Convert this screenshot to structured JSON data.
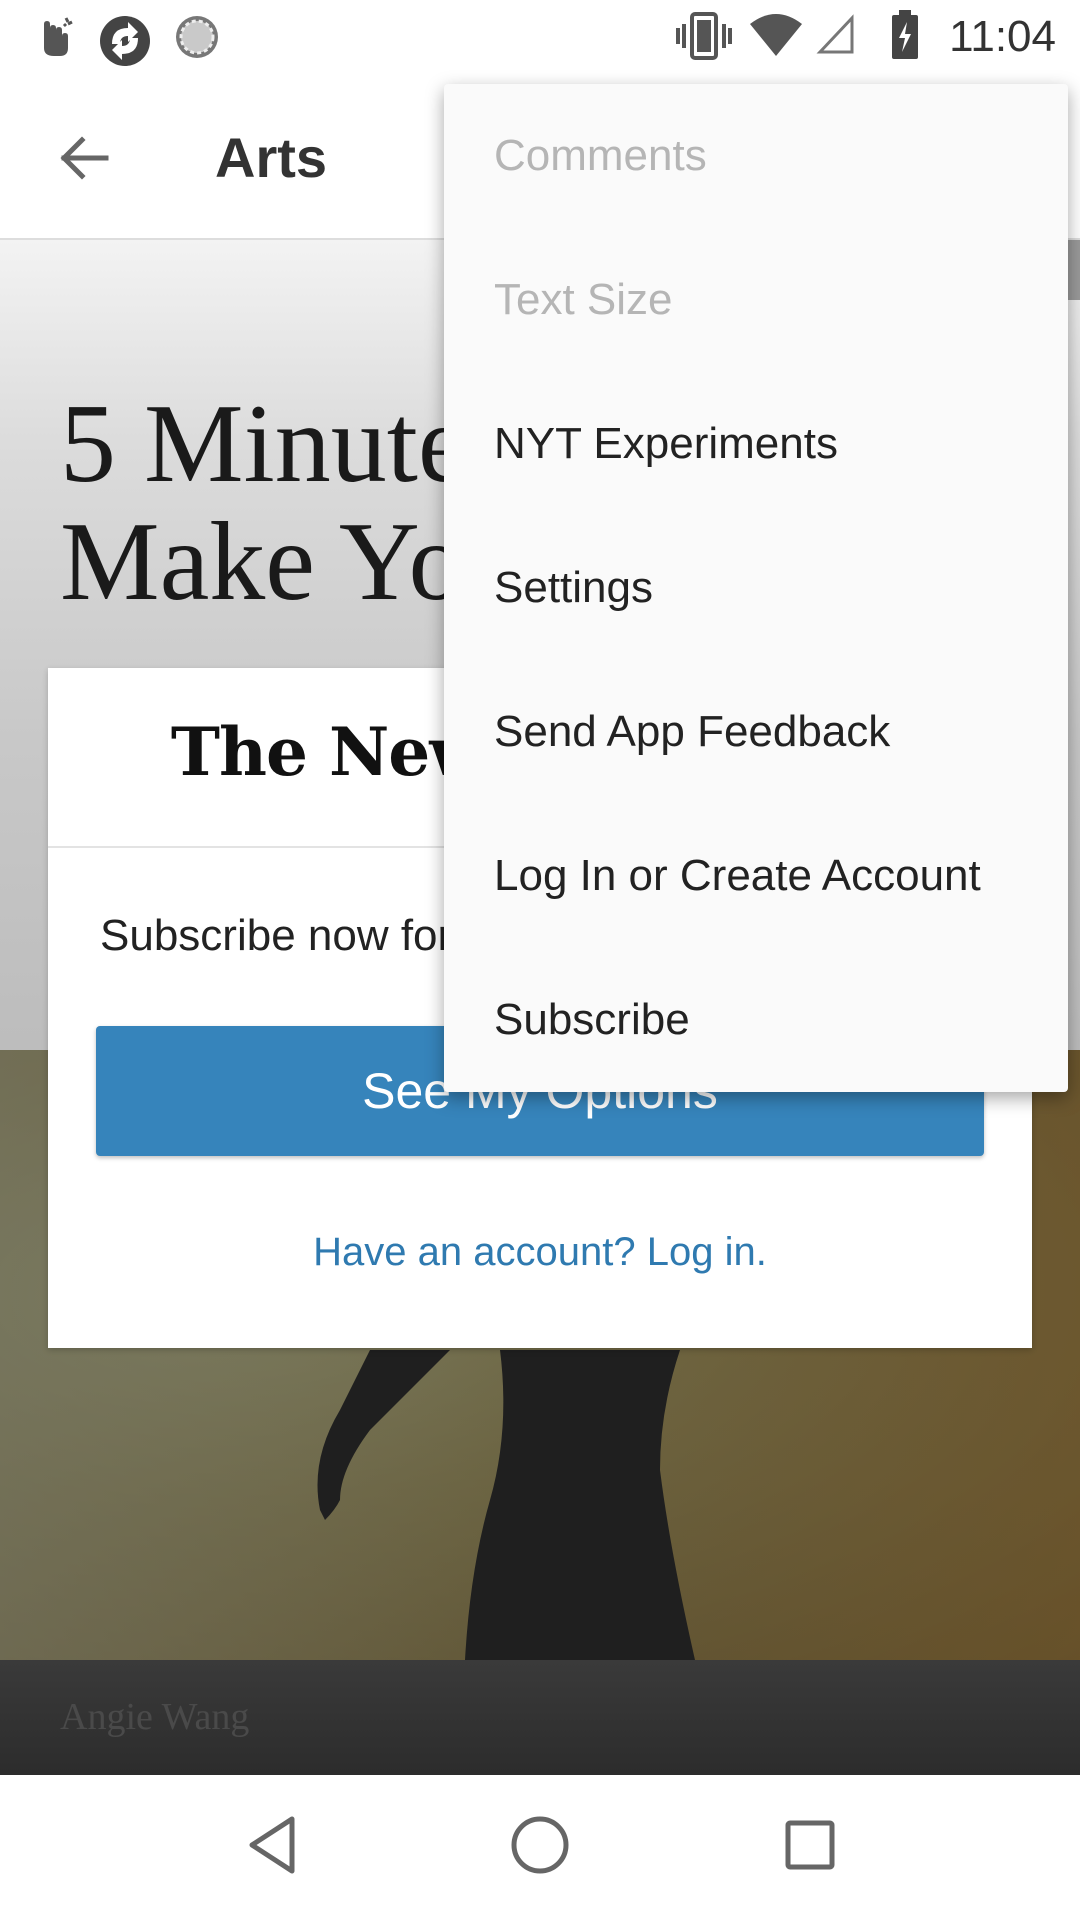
{
  "status_bar": {
    "time": "11:04",
    "left_icons": [
      "gesture-icon",
      "app-sync-icon",
      "loading-icon"
    ],
    "right_icons": [
      "vibrate-icon",
      "wifi-icon",
      "cell-signal-icon",
      "battery-charging-icon"
    ]
  },
  "toolbar": {
    "title": "Arts",
    "back_icon": "back-arrow-icon"
  },
  "article": {
    "headline_line1": "5 Minute",
    "headline_line2": "Make You",
    "photo_credit": "Angie Wang"
  },
  "paywall": {
    "logo_text": "The New York Times",
    "subscribe_text": "Subscribe now for unlimited access.",
    "options_button": "See My Options",
    "login_link": "Have an account? Log in.",
    "button_color": "#3684bb",
    "link_color": "#2f7ab0"
  },
  "overflow_menu": {
    "items": [
      {
        "label": "Comments",
        "enabled": false
      },
      {
        "label": "Text Size",
        "enabled": false
      },
      {
        "label": "NYT Experiments",
        "enabled": true
      },
      {
        "label": "Settings",
        "enabled": true
      },
      {
        "label": "Send App Feedback",
        "enabled": true
      },
      {
        "label": "Log In or Create Account",
        "enabled": true
      },
      {
        "label": "Subscribe",
        "enabled": true
      }
    ]
  },
  "nav_bar": {
    "back": "nav-back-icon",
    "home": "nav-home-icon",
    "recents": "nav-recents-icon"
  }
}
